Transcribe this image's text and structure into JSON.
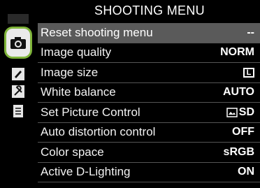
{
  "title": "SHOOTING MENU",
  "tabs": [
    {
      "name": "playback",
      "icon": "playback-icon"
    },
    {
      "name": "shooting",
      "icon": "camera-icon",
      "selected": true
    },
    {
      "name": "custom-settings",
      "icon": "pencil-icon"
    },
    {
      "name": "setup",
      "icon": "wrench-icon"
    },
    {
      "name": "retouch",
      "icon": "retouch-icon"
    }
  ],
  "menu": {
    "items": [
      {
        "label": "Reset shooting menu",
        "value": "--"
      },
      {
        "label": "Image quality",
        "value": "NORM"
      },
      {
        "label": "Image size",
        "value": "L",
        "icon": "image-size-icon"
      },
      {
        "label": "White balance",
        "value": "AUTO"
      },
      {
        "label": "Set Picture Control",
        "value": "SD",
        "icon": "picture-control-icon"
      },
      {
        "label": "Auto distortion control",
        "value": "OFF"
      },
      {
        "label": "Color space",
        "value": "sRGB"
      },
      {
        "label": "Active D-Lighting",
        "value": "ON"
      }
    ]
  },
  "colors": {
    "accent": "#7fb43a",
    "selected_row": "#5a5a5a",
    "background": "#000000"
  }
}
